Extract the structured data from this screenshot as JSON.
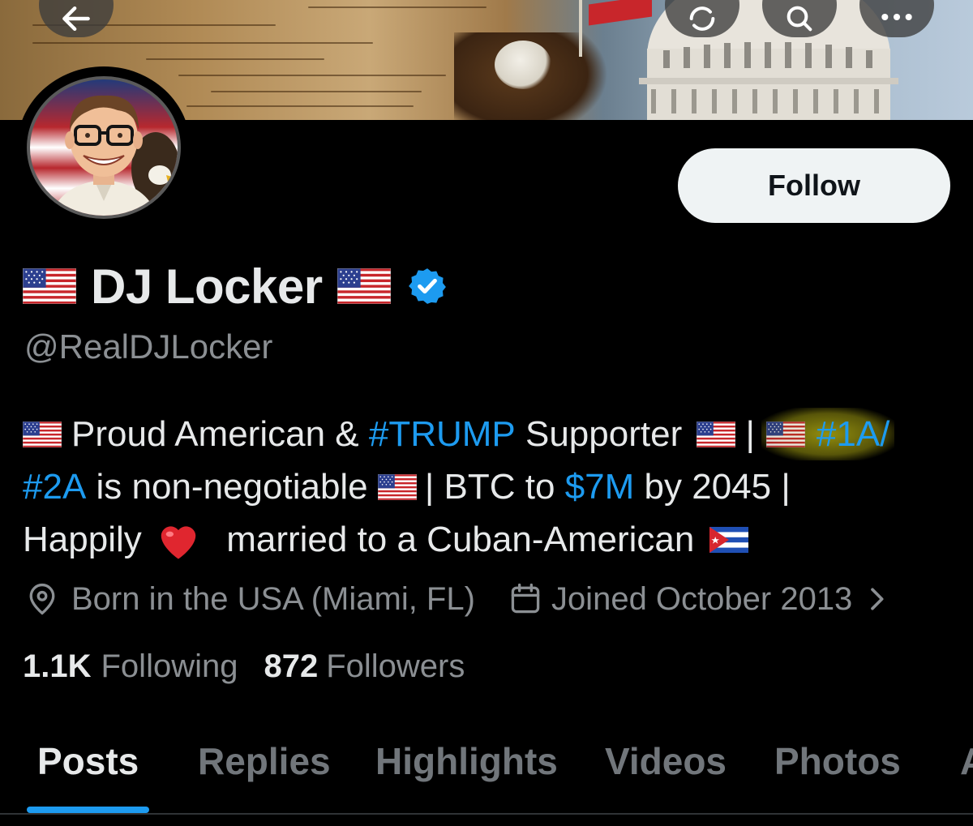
{
  "profile": {
    "display_name": "DJ Locker",
    "handle": "@RealDJLocker",
    "verified": true,
    "follow_label": "Follow"
  },
  "bio": {
    "l1_a": "Proud American & ",
    "l1_tag": "#TRUMP",
    "l1_b": " Supporter ",
    "l1_sep": "|",
    "l1_tag2": "#1A/",
    "l2_tag": "#2A",
    "l2_a": " is non-negotiable ",
    "l2_b": "| BTC to ",
    "l2_money": "$7M",
    "l2_c": " by 2045 |",
    "l3_a": "Happily ",
    "l3_b": " married to a Cuban-American "
  },
  "meta": {
    "location": "Born in the USA (Miami, FL)",
    "joined": "Joined October 2013"
  },
  "stats": {
    "following_count": "1.1K",
    "following_label": "Following",
    "followers_count": "872",
    "followers_label": "Followers"
  },
  "tabs": {
    "posts": "Posts",
    "replies": "Replies",
    "highlights": "Highlights",
    "videos": "Videos",
    "photos": "Photos",
    "more": "A"
  },
  "icons": {
    "back": "arrow-left-icon",
    "refresh": "refresh-icon",
    "search": "search-icon",
    "more": "more-icon",
    "location": "location-pin-icon",
    "calendar": "calendar-icon",
    "chevron": "chevron-right-icon",
    "verified": "verified-badge-icon",
    "heart": "heart-emoji",
    "us_flag": "us-flag-emoji",
    "cuba_flag": "cuba-flag-emoji"
  },
  "colors": {
    "accent": "#1d9bf0",
    "background": "#000000",
    "text": "#e7e9ea",
    "muted": "#8b8f93",
    "follow_bg": "#eff3f4",
    "highlight": "#c4be14"
  }
}
